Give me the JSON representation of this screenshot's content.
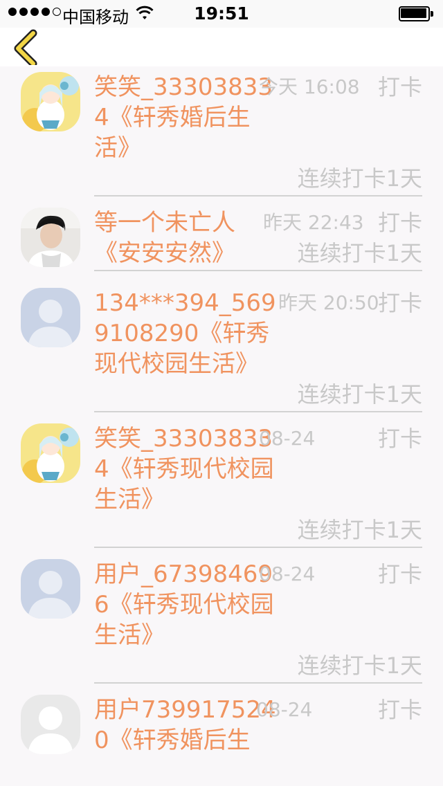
{
  "status_bar": {
    "carrier": "中国移动",
    "time": "19:51"
  },
  "nav": {
    "back_icon": "chevron-left-icon",
    "accent_color": "#f2d646"
  },
  "colors": {
    "name": "#f0935f",
    "meta": "#c8c8c8",
    "divider": "#d2d2d2"
  },
  "entries": [
    {
      "avatar": "anime-girl-avatar",
      "name": "笑笑_333038334《轩秀婚后生活》",
      "time": "今天 16:08",
      "checkin": "打卡",
      "streak": "连续打卡1天"
    },
    {
      "avatar": "young-man-photo-avatar",
      "name": "等一个未亡人《安安安然》",
      "time": "昨天 22:43",
      "checkin": "打卡",
      "streak": "连续打卡1天"
    },
    {
      "avatar": "default-user-avatar",
      "name": "134***394_5699108290《轩秀现代校园生活》",
      "time": "昨天 20:50",
      "checkin": "打卡",
      "streak": "连续打卡1天"
    },
    {
      "avatar": "anime-girl-avatar",
      "name": "笑笑_333038334《轩秀现代校园生活》",
      "time": "08-24",
      "checkin": "打卡",
      "streak": "连续打卡1天"
    },
    {
      "avatar": "default-user-avatar",
      "name": "用户_673984696《轩秀现代校园生活》",
      "time": "08-24",
      "checkin": "打卡",
      "streak": "连续打卡1天"
    },
    {
      "avatar": "grey-user-avatar",
      "name": "用户7399175240《轩秀婚后生",
      "time": "08-24",
      "checkin": "打卡",
      "streak": ""
    }
  ]
}
